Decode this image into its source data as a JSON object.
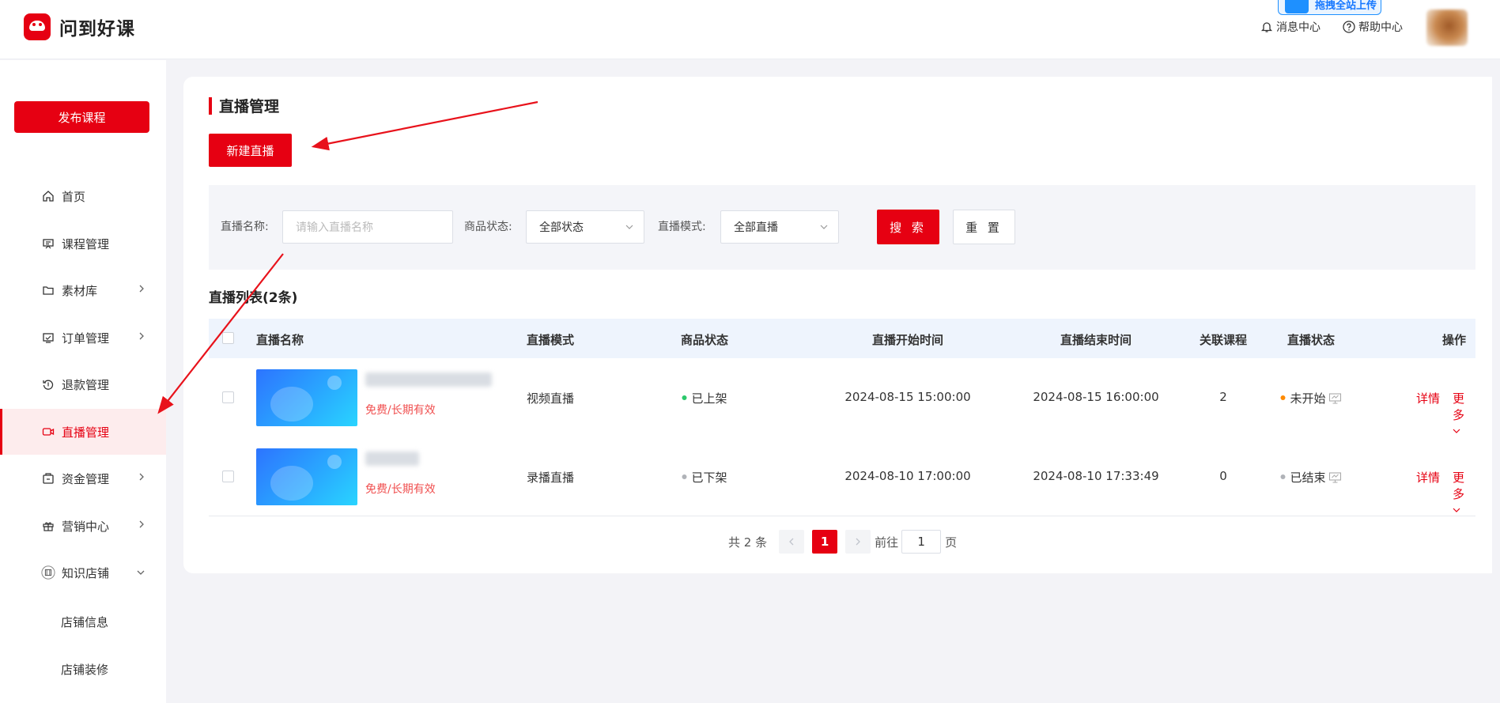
{
  "header": {
    "brand": "问到好课",
    "upload_badge": "拖拽全站上传",
    "message_center": "消息中心",
    "help_center": "帮助中心"
  },
  "sidebar": {
    "publish_label": "发布课程",
    "items": [
      {
        "label": "首页",
        "icon": "home-icon"
      },
      {
        "label": "课程管理",
        "icon": "course-icon"
      },
      {
        "label": "素材库",
        "icon": "folder-icon"
      },
      {
        "label": "订单管理",
        "icon": "order-icon"
      },
      {
        "label": "退款管理",
        "icon": "refund-icon"
      },
      {
        "label": "直播管理",
        "icon": "live-icon"
      },
      {
        "label": "资金管理",
        "icon": "wallet-icon"
      },
      {
        "label": "营销中心",
        "icon": "gift-icon"
      },
      {
        "label": "知识店铺",
        "icon": "shop-icon"
      }
    ],
    "sub_items": [
      "店铺信息",
      "店铺装修"
    ]
  },
  "main": {
    "title": "直播管理",
    "new_live_label": "新建直播",
    "filter": {
      "name_label": "直播名称:",
      "name_placeholder": "请输入直播名称",
      "status_label": "商品状态:",
      "status_value": "全部状态",
      "mode_label": "直播模式:",
      "mode_value": "全部直播",
      "search_label": "搜 索",
      "reset_label": "重 置"
    },
    "list_title": "直播列表(2条)",
    "columns": [
      "直播名称",
      "直播模式",
      "商品状态",
      "直播开始时间",
      "直播结束时间",
      "关联课程",
      "直播状态",
      "操作"
    ],
    "rows": [
      {
        "price": "免费/长期有效",
        "mode": "视频直播",
        "goods_status": "已上架",
        "goods_status_color": "#2bc86b",
        "start": "2024-08-15 15:00:00",
        "end": "2024-08-15 16:00:00",
        "courses": "2",
        "live_status": "未开始",
        "live_status_color": "#ff8a00",
        "detail": "详情",
        "more": "更多"
      },
      {
        "price": "免费/长期有效",
        "mode": "录播直播",
        "goods_status": "已下架",
        "goods_status_color": "#b0b3b8",
        "start": "2024-08-10 17:00:00",
        "end": "2024-08-10 17:33:49",
        "courses": "0",
        "live_status": "已结束",
        "live_status_color": "#b0b3b8",
        "detail": "详情",
        "more": "更多"
      }
    ],
    "pagination": {
      "total": "共 2 条",
      "current": "1",
      "goto_label": "前往",
      "goto_value": "1",
      "page_suffix": "页"
    }
  },
  "colors": {
    "accent": "#e60012"
  }
}
